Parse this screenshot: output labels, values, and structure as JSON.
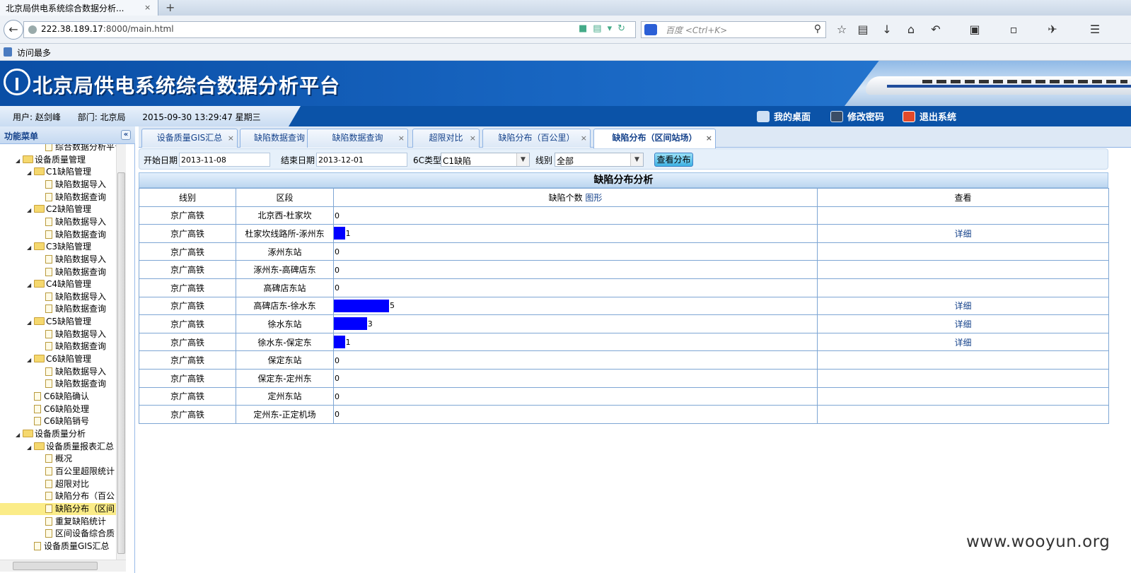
{
  "browser": {
    "tab_title": "北京局供电系统综合数据分析...",
    "tab_close": "×",
    "new_tab": "+",
    "url_host": "222.38.189.17",
    "url_rest": ":8000/main.html",
    "search_placeholder": "百度 <Ctrl+K>",
    "bookmark": "访问最多"
  },
  "app": {
    "title": "北京局供电系统综合数据分析平台",
    "user_label": "用户: 赵剑峰",
    "dept_label": "部门: 北京局",
    "datetime": "2015-09-30 13:29:47 星期三",
    "links": [
      "我的桌面",
      "修改密码",
      "退出系统"
    ]
  },
  "sidebar": {
    "title": "功能菜单",
    "collapse": "«",
    "items": [
      {
        "label": "综合数据分析平台门户",
        "level": 3,
        "type": "file"
      },
      {
        "label": "设备质量管理",
        "level": 1,
        "type": "folder"
      },
      {
        "label": "C1缺陷管理",
        "level": 2,
        "type": "folder"
      },
      {
        "label": "缺陷数据导入",
        "level": 3,
        "type": "file"
      },
      {
        "label": "缺陷数据查询",
        "level": 3,
        "type": "file"
      },
      {
        "label": "C2缺陷管理",
        "level": 2,
        "type": "folder"
      },
      {
        "label": "缺陷数据导入",
        "level": 3,
        "type": "file"
      },
      {
        "label": "缺陷数据查询",
        "level": 3,
        "type": "file"
      },
      {
        "label": "C3缺陷管理",
        "level": 2,
        "type": "folder"
      },
      {
        "label": "缺陷数据导入",
        "level": 3,
        "type": "file"
      },
      {
        "label": "缺陷数据查询",
        "level": 3,
        "type": "file"
      },
      {
        "label": "C4缺陷管理",
        "level": 2,
        "type": "folder"
      },
      {
        "label": "缺陷数据导入",
        "level": 3,
        "type": "file"
      },
      {
        "label": "缺陷数据查询",
        "level": 3,
        "type": "file"
      },
      {
        "label": "C5缺陷管理",
        "level": 2,
        "type": "folder"
      },
      {
        "label": "缺陷数据导入",
        "level": 3,
        "type": "file"
      },
      {
        "label": "缺陷数据查询",
        "level": 3,
        "type": "file"
      },
      {
        "label": "C6缺陷管理",
        "level": 2,
        "type": "folder"
      },
      {
        "label": "缺陷数据导入",
        "level": 3,
        "type": "file"
      },
      {
        "label": "缺陷数据查询",
        "level": 3,
        "type": "file"
      },
      {
        "label": "C6缺陷确认",
        "level": 2,
        "type": "file"
      },
      {
        "label": "C6缺陷处理",
        "level": 2,
        "type": "file"
      },
      {
        "label": "C6缺陷销号",
        "level": 2,
        "type": "file"
      },
      {
        "label": "设备质量分析",
        "level": 1,
        "type": "folder"
      },
      {
        "label": "设备质量报表汇总",
        "level": 2,
        "type": "folder"
      },
      {
        "label": "概况",
        "level": 3,
        "type": "file"
      },
      {
        "label": "百公里超限统计",
        "level": 3,
        "type": "file"
      },
      {
        "label": "超限对比",
        "level": 3,
        "type": "file"
      },
      {
        "label": "缺陷分布（百公",
        "level": 3,
        "type": "file"
      },
      {
        "label": "缺陷分布（区间",
        "level": 3,
        "type": "file",
        "selected": true
      },
      {
        "label": "重复缺陷统计",
        "level": 3,
        "type": "file"
      },
      {
        "label": "区间设备综合质",
        "level": 3,
        "type": "file"
      },
      {
        "label": "设备质量GIS汇总",
        "level": 2,
        "type": "file"
      }
    ]
  },
  "tabs": [
    {
      "label": "设备质量GIS汇总"
    },
    {
      "label": "缺陷数据查询"
    },
    {
      "label": "缺陷数据查询"
    },
    {
      "label": "超限对比"
    },
    {
      "label": "缺陷分布（百公里）"
    },
    {
      "label": "缺陷分布（区间站场）",
      "active": true
    }
  ],
  "filter": {
    "start_label": "开始日期",
    "start_value": "2013-11-08",
    "end_label": "结束日期",
    "end_value": "2013-12-01",
    "type_label": "6C类型",
    "type_value": "C1缺陷",
    "line_label": "线别",
    "line_value": "全部",
    "query_button": "查看分布"
  },
  "report": {
    "title": "缺陷分布分析",
    "columns": {
      "line": "线别",
      "section": "区段",
      "count": "缺陷个数",
      "count_link": "图形",
      "view": "查看"
    },
    "rows": [
      {
        "line": "京广高铁",
        "section": "北京西-杜家坎",
        "count": 0,
        "view": ""
      },
      {
        "line": "京广高铁",
        "section": "杜家坎线路所-涿州东",
        "count": 1,
        "view": "详细"
      },
      {
        "line": "京广高铁",
        "section": "涿州东站",
        "count": 0,
        "view": ""
      },
      {
        "line": "京广高铁",
        "section": "涿州东-高碑店东",
        "count": 0,
        "view": ""
      },
      {
        "line": "京广高铁",
        "section": "高碑店东站",
        "count": 0,
        "view": ""
      },
      {
        "line": "京广高铁",
        "section": "高碑店东-徐水东",
        "count": 5,
        "view": "详细"
      },
      {
        "line": "京广高铁",
        "section": "徐水东站",
        "count": 3,
        "view": "详细"
      },
      {
        "line": "京广高铁",
        "section": "徐水东-保定东",
        "count": 1,
        "view": "详细"
      },
      {
        "line": "京广高铁",
        "section": "保定东站",
        "count": 0,
        "view": ""
      },
      {
        "line": "京广高铁",
        "section": "保定东-定州东",
        "count": 0,
        "view": ""
      },
      {
        "line": "京广高铁",
        "section": "定州东站",
        "count": 0,
        "view": ""
      },
      {
        "line": "京广高铁",
        "section": "定州东-正定机场",
        "count": 0,
        "view": ""
      }
    ]
  },
  "watermark": "www.wooyun.org",
  "colors": {
    "bar": "#0000ff",
    "header_blue": "#0b53a8"
  }
}
